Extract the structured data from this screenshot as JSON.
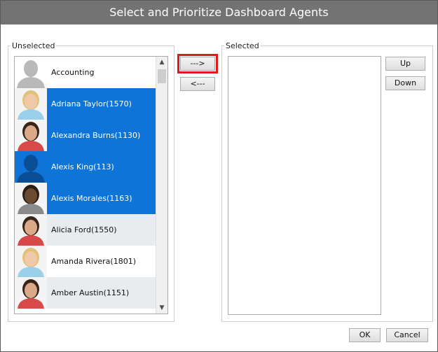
{
  "dialog": {
    "title": "Select and Prioritize Dashboard Agents"
  },
  "unselected": {
    "legend": "Unselected",
    "items": [
      {
        "label": "Accounting",
        "avatar": "generic-silhouette-gray",
        "state": "normal"
      },
      {
        "label": "Adriana Taylor(1570)",
        "avatar": "person-photo-woman-blonde",
        "state": "selected"
      },
      {
        "label": "Alexandra Burns(1130)",
        "avatar": "person-photo-woman-dark-hair",
        "state": "selected"
      },
      {
        "label": "Alexis King(113)",
        "avatar": "generic-silhouette-blue",
        "state": "selected"
      },
      {
        "label": "Alexis Morales(1163)",
        "avatar": "person-photo-man",
        "state": "selected"
      },
      {
        "label": "Alicia Ford(1550)",
        "avatar": "person-photo-woman-dark-hair",
        "state": "alt"
      },
      {
        "label": "Amanda Rivera(1801)",
        "avatar": "person-photo-woman-blonde",
        "state": "normal"
      },
      {
        "label": "Amber Austin(1151)",
        "avatar": "person-photo-woman-dark-hair",
        "state": "alt"
      }
    ]
  },
  "selected": {
    "legend": "Selected",
    "items": []
  },
  "buttons": {
    "move_right": "--->",
    "move_left": "<---",
    "up": "Up",
    "down": "Down",
    "ok": "OK",
    "cancel": "Cancel"
  },
  "scrollbar": {
    "up_glyph": "▲",
    "down_glyph": "▼"
  },
  "colors": {
    "titlebar": "#737373",
    "selection": "#0f74d8",
    "alt_row": "#e8ecef",
    "highlight": "#e11919"
  }
}
